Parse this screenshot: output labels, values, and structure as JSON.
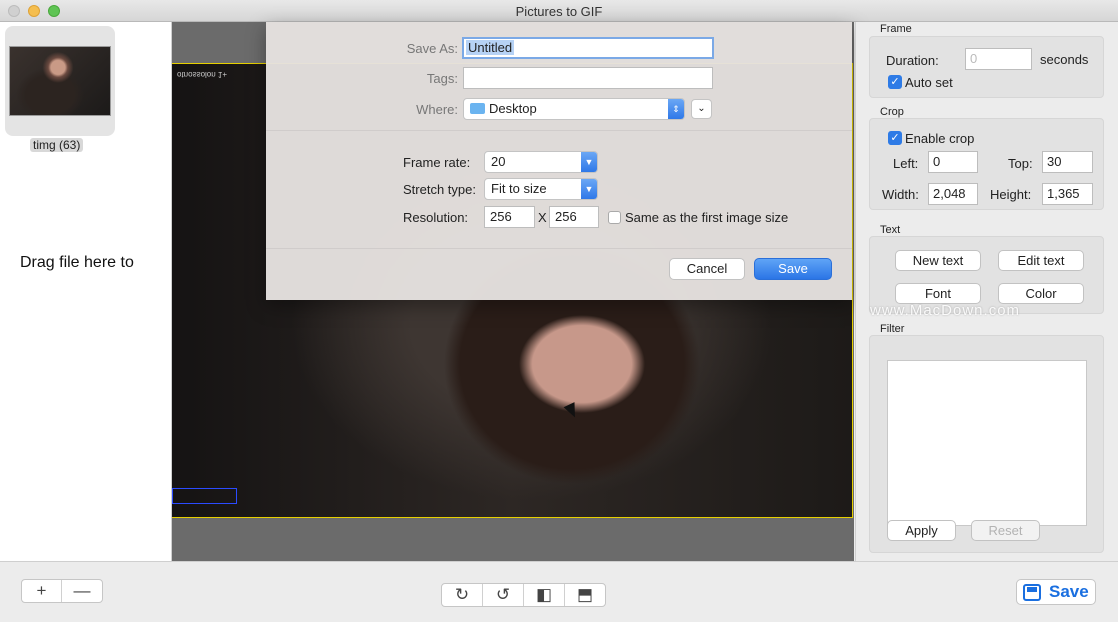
{
  "window": {
    "title": "Pictures to GIF"
  },
  "sidebar": {
    "thumb_label": "timg (63)",
    "drag_hint": "Drag file here to"
  },
  "canvas": {
    "photo_text": "otnossolon 1+"
  },
  "save_sheet": {
    "save_as_label": "Save As:",
    "save_as_value": "Untitled",
    "tags_label": "Tags:",
    "tags_value": "",
    "where_label": "Where:",
    "where_value": "Desktop",
    "frame_rate_label": "Frame rate:",
    "frame_rate_value": "20",
    "stretch_label": "Stretch type:",
    "stretch_value": "Fit to size",
    "resolution_label": "Resolution:",
    "res_width": "256",
    "res_x": "X",
    "res_height": "256",
    "same_size_label": "Same as the first image size",
    "same_size_checked": false,
    "cancel_label": "Cancel",
    "save_label": "Save"
  },
  "right_panel": {
    "frame": {
      "title": "Frame",
      "duration_label": "Duration:",
      "duration_placeholder": "0",
      "seconds_label": "seconds",
      "auto_set_label": "Auto set",
      "auto_set_checked": true
    },
    "crop": {
      "title": "Crop",
      "enable_label": "Enable crop",
      "enable_checked": true,
      "left_label": "Left:",
      "left_value": "0",
      "top_label": "Top:",
      "top_value": "30",
      "width_label": "Width:",
      "width_value": "2,048",
      "height_label": "Height:",
      "height_value": "1,365"
    },
    "text": {
      "title": "Text",
      "new_text": "New text",
      "edit_text": "Edit text",
      "font": "Font",
      "color": "Color"
    },
    "filter": {
      "title": "Filter",
      "apply": "Apply",
      "reset": "Reset"
    }
  },
  "watermark": "www.MacDown.com",
  "bottom": {
    "add_icon": "+",
    "remove_icon": "—",
    "save_label": "Save"
  },
  "colors": {
    "accent": "#2e7be6",
    "selection_border": "#e6d000"
  }
}
